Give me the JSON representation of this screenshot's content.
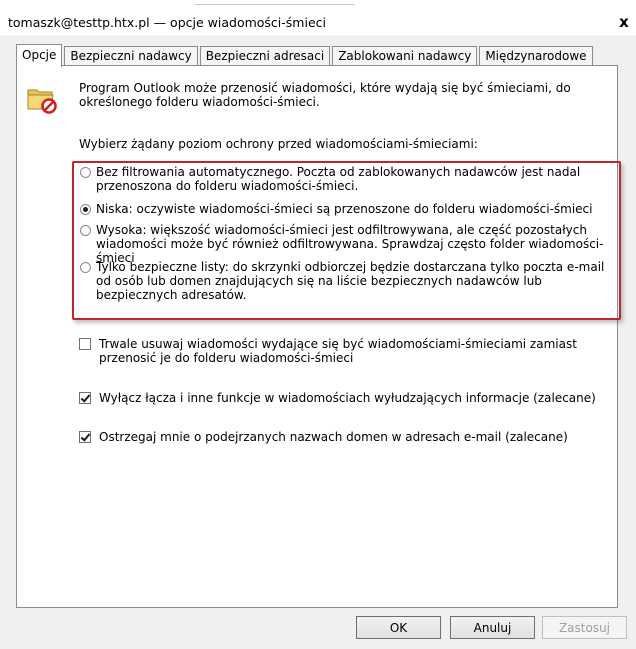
{
  "window": {
    "title": "tomaszk@testtp.htx.pl — opcje wiadomości-śmieci",
    "close_label": "x"
  },
  "tabs": [
    {
      "label": "Opcje"
    },
    {
      "label": "Bezpieczni nadawcy"
    },
    {
      "label": "Bezpieczni adresaci"
    },
    {
      "label": "Zablokowani nadawcy"
    },
    {
      "label": "Międzynarodowe"
    }
  ],
  "options": {
    "intro": "Program Outlook może przenosić wiadomości, które wydają się być śmieciami, do określonego folderu wiadomości-śmieci.",
    "level_prompt": "Wybierz żądany poziom ochrony przed wiadomościami-śmieciami:",
    "radios": [
      {
        "label": "Bez filtrowania automatycznego. Poczta od zablokowanych nadawców jest nadal przenoszona do folderu wiadomości-śmieci.",
        "checked": false
      },
      {
        "label": "Niska: oczywiste wiadomości-śmieci są przenoszone do folderu wiadomości-śmieci",
        "checked": true
      },
      {
        "label": "Wysoka: większość wiadomości-śmieci jest odfiltrowywana, ale część pozostałych wiadomości może być również odfiltrowywana. Sprawdzaj często folder wiadomości-śmieci",
        "checked": false
      },
      {
        "label": "Tylko bezpieczne listy: do skrzynki odbiorczej będzie dostarczana tylko poczta e-mail od osób lub domen znajdujących się na liście bezpiecznych nadawców lub bezpiecznych adresatów.",
        "checked": false
      }
    ],
    "checkboxes": [
      {
        "label": "Trwale usuwaj wiadomości wydające się być wiadomościami-śmieciami zamiast przenosić je do folderu wiadomości-śmieci",
        "checked": false
      },
      {
        "label": "Wyłącz łącza i inne funkcje w wiadomościach wyłudzających informacje (zalecane)",
        "checked": true
      },
      {
        "label": "Ostrzegaj mnie o podejrzanych nazwach domen w adresach e-mail (zalecane)",
        "checked": true
      }
    ]
  },
  "buttons": {
    "ok": "OK",
    "cancel": "Anuluj",
    "apply": "Zastosuj"
  },
  "colors": {
    "highlight_border": "#c0262c",
    "tab_border": "#898c95"
  },
  "icons": {
    "folder": "junk-folder-icon",
    "close": "close-icon"
  }
}
